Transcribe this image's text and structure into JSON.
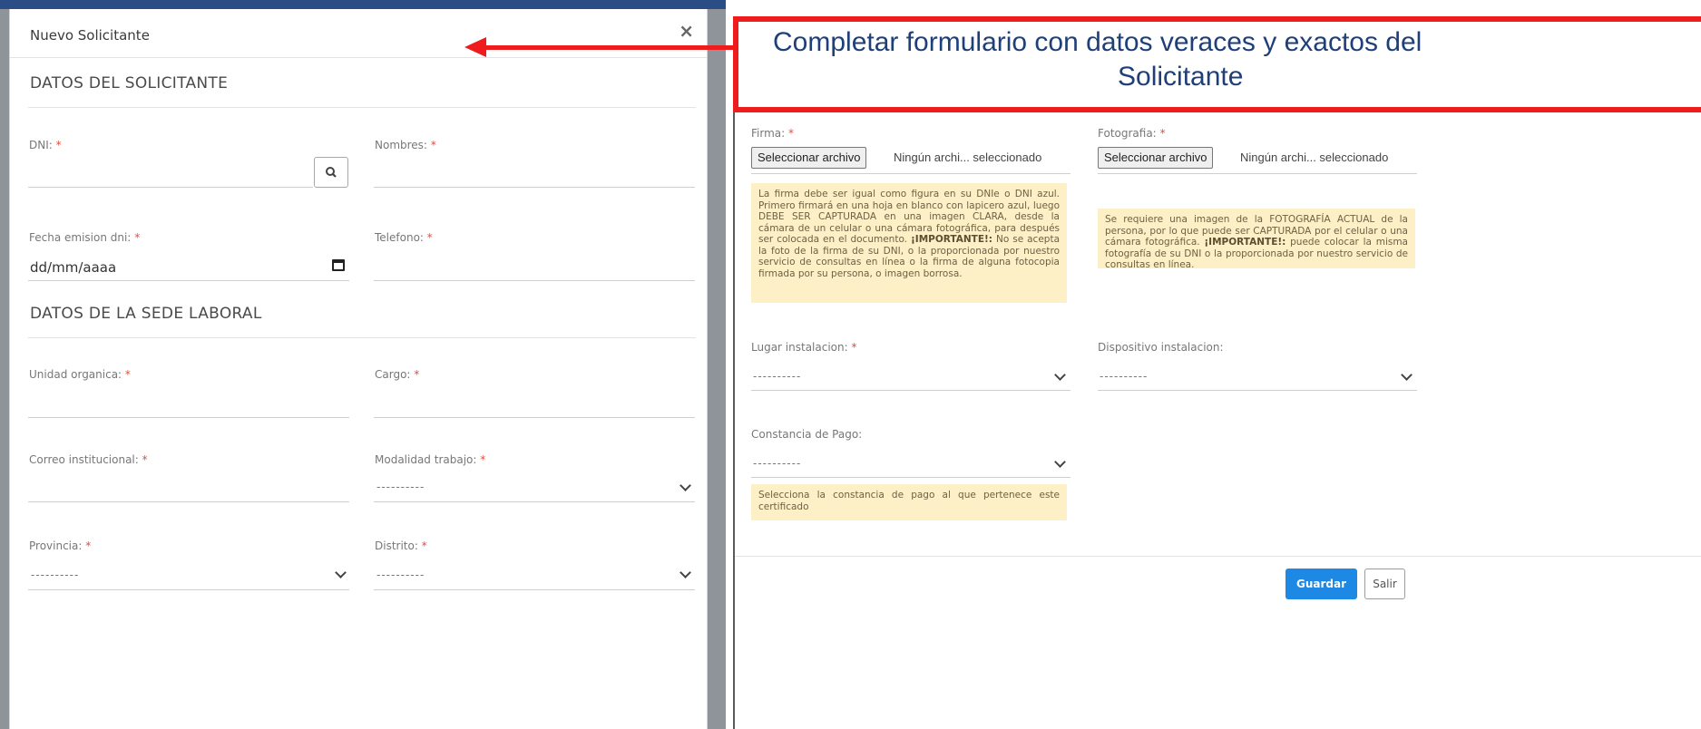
{
  "modal": {
    "title": "Nuevo Solicitante",
    "close": "×"
  },
  "sections": {
    "applicant": "DATOS DEL SOLICITANTE",
    "workplace": "DATOS DE LA SEDE LABORAL"
  },
  "fields": {
    "dni": "DNI:",
    "nombres": "Nombres:",
    "fecha_emision": "Fecha emision dni:",
    "fecha_placeholder": "dd/mm/aaaa",
    "telefono": "Telefono:",
    "unidad_organica": "Unidad organica:",
    "cargo": "Cargo:",
    "correo": "Correo institucional:",
    "modalidad": "Modalidad trabajo:",
    "provincia": "Provincia:",
    "distrito": "Distrito:",
    "firma": "Firma:",
    "fotografia": "Fotografia:",
    "lugar": "Lugar instalacion:",
    "dispositivo": "Dispositivo instalacion:",
    "constancia": "Constancia de Pago:",
    "required_mark": "*"
  },
  "select_placeholder": "----------",
  "file": {
    "button": "Seleccionar archivo",
    "status": "Ningún archi... seleccionado"
  },
  "notes": {
    "firma_a": "La firma debe ser igual como figura en su DNIe o DNI azul. Primero firmará en una hoja en blanco con lapicero azul, luego DEBE SER CAPTURADA en una imagen CLARA, desde la cámara de un celular o una cámara fotográfica, para después ser colocada en el documento.",
    "firma_bold": "¡IMPORTANTE!:",
    "firma_b": "No se acepta la foto de la firma de su DNI, o la proporcionada por nuestro servicio de consultas en línea o la firma de alguna fotocopia firmada por su persona, o imagen borrosa.",
    "foto_a": "Se requiere una imagen de la FOTOGRAFÍA ACTUAL de la persona, por lo que puede ser CAPTURADA por el celular o una cámara fotográfica.",
    "foto_bold": "¡IMPORTANTE!:",
    "foto_b": "puede colocar la misma fotografía de su DNI o la proporcionada por nuestro servicio de consultas en línea.",
    "constancia": "Selecciona la constancia de pago al que pertenece este certificado"
  },
  "annotation": {
    "line1": "Completar formulario con datos veraces y exactos del",
    "line2": "Solicitante"
  },
  "buttons": {
    "save": "Guardar",
    "exit": "Salir"
  },
  "colors": {
    "primary": "#1e88e5",
    "required": "#e74c3c",
    "annotation_red": "#ee1c1c",
    "annotation_text": "#1f3f79",
    "note_bg": "#fdefc6"
  }
}
